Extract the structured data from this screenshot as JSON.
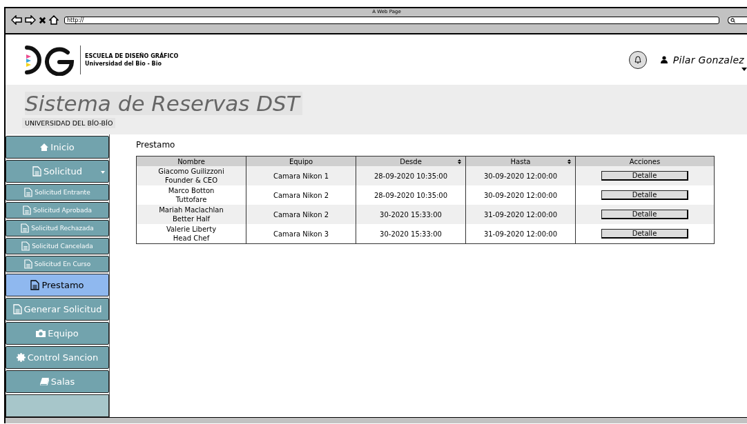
{
  "browser": {
    "title": "A Web Page",
    "url": "http://"
  },
  "header": {
    "school": "ESCUELA DE DISEÑO GRÁFICO",
    "university": "Universidad del Bio - Bio",
    "user": "Pilar Gonzalez"
  },
  "banner": {
    "title": "Sistema de Reservas DST",
    "subtitle": "UNIVERSIDAD DEL BÍO-BÍO"
  },
  "sidebar": {
    "items": [
      {
        "label": "Inicio",
        "selected": false
      },
      {
        "label": "Solicitud",
        "selected": false,
        "expanded": true,
        "children": [
          {
            "label": "Solicitud Entrante",
            "selected": false
          },
          {
            "label": "Solicitud Aprobada",
            "selected": false
          },
          {
            "label": "Solicitud Rechazada",
            "selected": false
          },
          {
            "label": "Solicitud Cancelada",
            "selected": false
          },
          {
            "label": "Solicitud En Curso",
            "selected": false
          }
        ]
      },
      {
        "label": "Prestamo",
        "selected": true
      },
      {
        "label": "Generar Solicitud",
        "selected": false
      },
      {
        "label": "Equipo",
        "selected": false
      },
      {
        "label": "Control Sancion",
        "selected": false
      },
      {
        "label": "Salas",
        "selected": false
      }
    ]
  },
  "content": {
    "title": "Prestamo",
    "table": {
      "columns": [
        {
          "label": "Nombre",
          "sortable": false
        },
        {
          "label": "Equipo",
          "sortable": false
        },
        {
          "label": "Desde",
          "sortable": true
        },
        {
          "label": "Hasta",
          "sortable": true
        },
        {
          "label": "Acciones",
          "sortable": false
        }
      ],
      "rows": [
        {
          "nombre": "Giacomo Guilizzoni\nFounder & CEO",
          "equipo": "Camara Nikon 1",
          "desde": "28-09-2020 10:35:00",
          "hasta": "30-09-2020 12:00:00",
          "accion": "Detalle"
        },
        {
          "nombre": "Marco Botton\nTuttofare",
          "equipo": "Camara Nikon 2",
          "desde": "28-09-2020 10:35:00",
          "hasta": "30-09-2020 12:00:00",
          "accion": "Detalle"
        },
        {
          "nombre": "Mariah Maclachlan\nBetter Half",
          "equipo": "Camara Nikon 2",
          "desde": "30-2020 15:33:00",
          "hasta": "31-09-2020 12:00:00",
          "accion": "Detalle"
        },
        {
          "nombre": "Valerie Liberty\nHead Chef",
          "equipo": "Camara Nikon 3",
          "desde": "30-2020 15:33:00",
          "hasta": "31-09-2020 12:00:00",
          "accion": "Detalle"
        }
      ]
    }
  }
}
